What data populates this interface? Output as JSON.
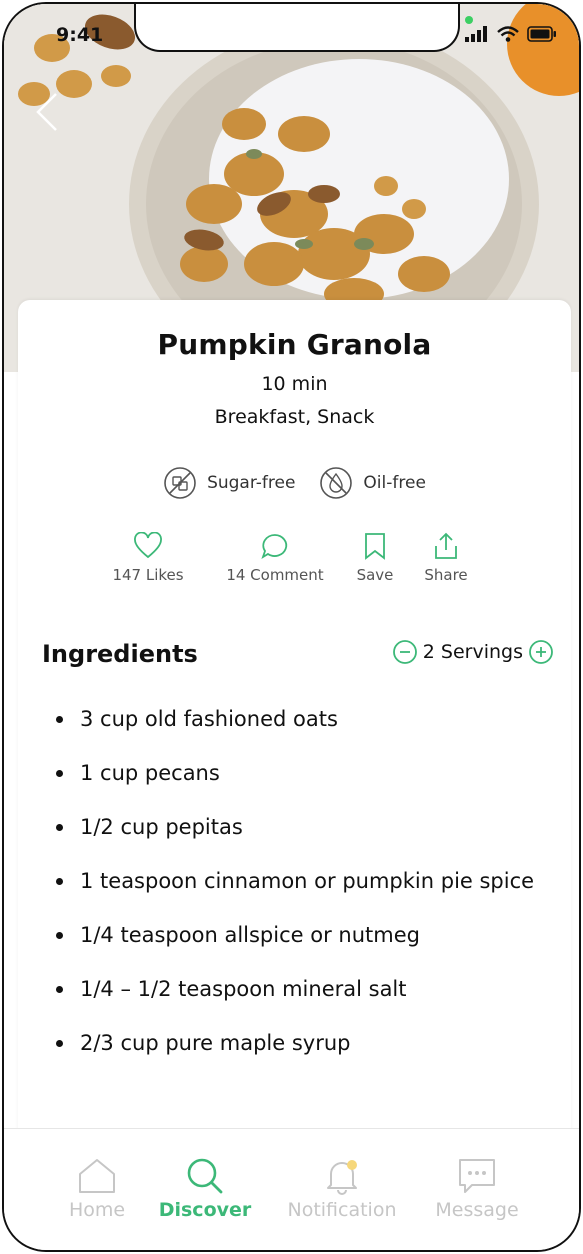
{
  "status": {
    "time": "9:41"
  },
  "recipe": {
    "title": "Pumpkin Granola",
    "time": "10 min",
    "categories": "Breakfast, Snack",
    "tags": [
      {
        "label": "Sugar-free",
        "icon": "no-sugar-icon"
      },
      {
        "label": "Oil-free",
        "icon": "no-oil-icon"
      }
    ]
  },
  "actions": {
    "likes": "147 Likes",
    "comments": "14 Comment",
    "save": "Save",
    "share": "Share"
  },
  "ingredients": {
    "title": "Ingredients",
    "servings": "2 Servings",
    "items": [
      "3 cup old fashioned oats",
      "1 cup pecans",
      "1/2 cup pepitas",
      "1 teaspoon cinnamon or pumpkin pie spice",
      "1/4 teaspoon allspice or nutmeg",
      "1/4 – 1/2 teaspoon mineral salt",
      "2/3 cup pure maple syrup"
    ]
  },
  "tabbar": {
    "home": "Home",
    "discover": "Discover",
    "notification": "Notification",
    "message": "Message"
  },
  "colors": {
    "accent": "#3cb878",
    "inactive": "#c6c6c6"
  }
}
